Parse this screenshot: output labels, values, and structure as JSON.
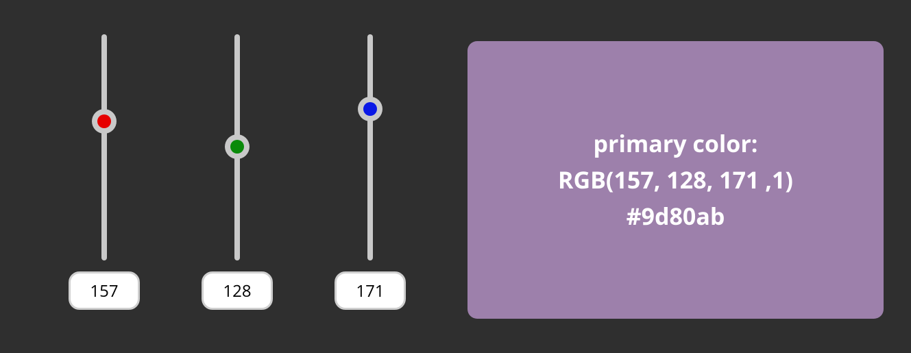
{
  "color": {
    "r": 157,
    "g": 128,
    "b": 171,
    "a": 1,
    "hex": "#9d80ab",
    "rgb_label": "RGB(157, 128, 171 ,1)"
  },
  "sliders": {
    "max": 255,
    "red": {
      "value": 157,
      "thumb_color": "#e60000"
    },
    "green": {
      "value": 128,
      "thumb_color": "#0a8a0a"
    },
    "blue": {
      "value": 171,
      "thumb_color": "#0a18e6"
    }
  },
  "swatch": {
    "title": "primary color:",
    "hex_line": "#9d80ab"
  }
}
